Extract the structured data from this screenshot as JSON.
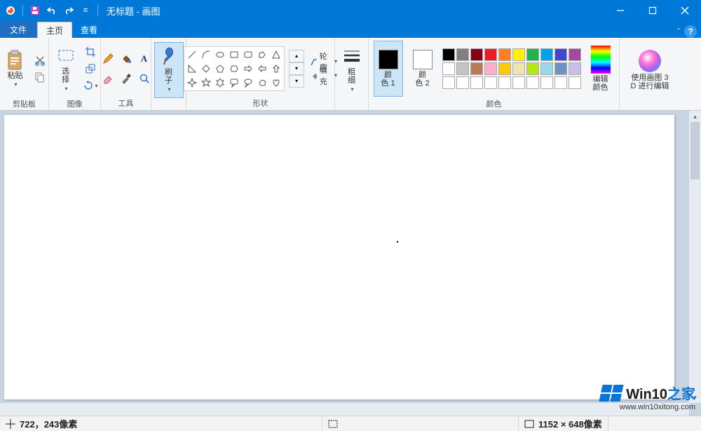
{
  "title": "无标题 - 画图",
  "tabs": {
    "file": "文件",
    "home": "主页",
    "view": "查看"
  },
  "groups": {
    "clipboard": {
      "label": "剪贴板",
      "paste": "粘贴"
    },
    "image": {
      "label": "图像",
      "select": "选\n择"
    },
    "tools": {
      "label": "工具"
    },
    "shapes": {
      "label": "形状",
      "outline": "轮廓",
      "fill": "填充"
    },
    "brush": {
      "label": "刷\n子"
    },
    "size": {
      "label": "粗\n细"
    },
    "colors": {
      "label": "颜色",
      "color1": "颜\n色 1",
      "color2": "颜\n色 2",
      "edit": "编辑\n颜色"
    },
    "paint3d": {
      "label": "使用画图 3\nD 进行编辑"
    }
  },
  "palette": [
    [
      "#000000",
      "#7f7f7f",
      "#880015",
      "#ed1c24",
      "#ff7f27",
      "#fff200",
      "#22b14c",
      "#00a2e8",
      "#3f48cc",
      "#a349a4"
    ],
    [
      "#ffffff",
      "#c3c3c3",
      "#b97a57",
      "#ffaec9",
      "#ffc90e",
      "#efe4b0",
      "#b5e61d",
      "#99d9ea",
      "#7092be",
      "#c8bfe7"
    ]
  ],
  "color1": "#000000",
  "color2": "#ffffff",
  "status": {
    "cursor": "722，243像素",
    "canvas": "1152 × 648像素"
  },
  "watermark": {
    "brand_en": "Win10",
    "brand_zh": "之家",
    "url": "www.win10xitong.com"
  }
}
